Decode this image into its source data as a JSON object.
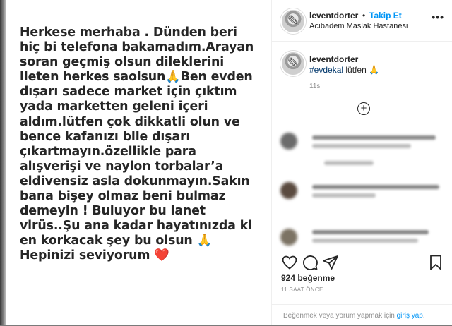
{
  "post": {
    "text_lines": [
      "Herkese merhaba . Dünden beri",
      "hiç bi telefona bakamadım.Arayan",
      "soran geçmiş olsun dileklerini",
      "ileten herkes saolsun🙏Ben evden",
      "dışarı sadece market için çıktım",
      "yada marketten geleni içeri",
      "aldım.lütfen çok dikkatli olun ve",
      "bence kafanızı bile dışarı",
      "çıkartmayın.özellikle para",
      "alışverişi ve naylon torbalar’a",
      "eldivensiz asla dokunmayın.Sakın",
      "bana bişey olmaz beni bulmaz",
      "demeyin ! Buluyor bu lanet",
      "virüs..Şu ana kadar hayatınızda ki",
      "en korkacak şey bu olsun 🙏",
      "Hepinizi seviyorum ❤️"
    ]
  },
  "header": {
    "username": "leventdorter",
    "separator": "•",
    "follow_label": "Takip Et",
    "location": "Acıbadem Maslak Hastanesi",
    "more_label": "•••"
  },
  "caption": {
    "username": "leventdorter",
    "hashtag": "#evdekal",
    "text": "lütfen 🙏",
    "time": "11s"
  },
  "load_more_label": "+",
  "actions": {
    "like_icon": "heart-icon",
    "comment_icon": "comment-icon",
    "share_icon": "paper-plane-icon",
    "save_icon": "bookmark-icon"
  },
  "likes": "924 beğenme",
  "timestamp": "11 SAAT ÖNCE",
  "footer": {
    "prefix": "Beğenmek veya yorum yapmak için ",
    "link": "giriş yap",
    "suffix": "."
  }
}
